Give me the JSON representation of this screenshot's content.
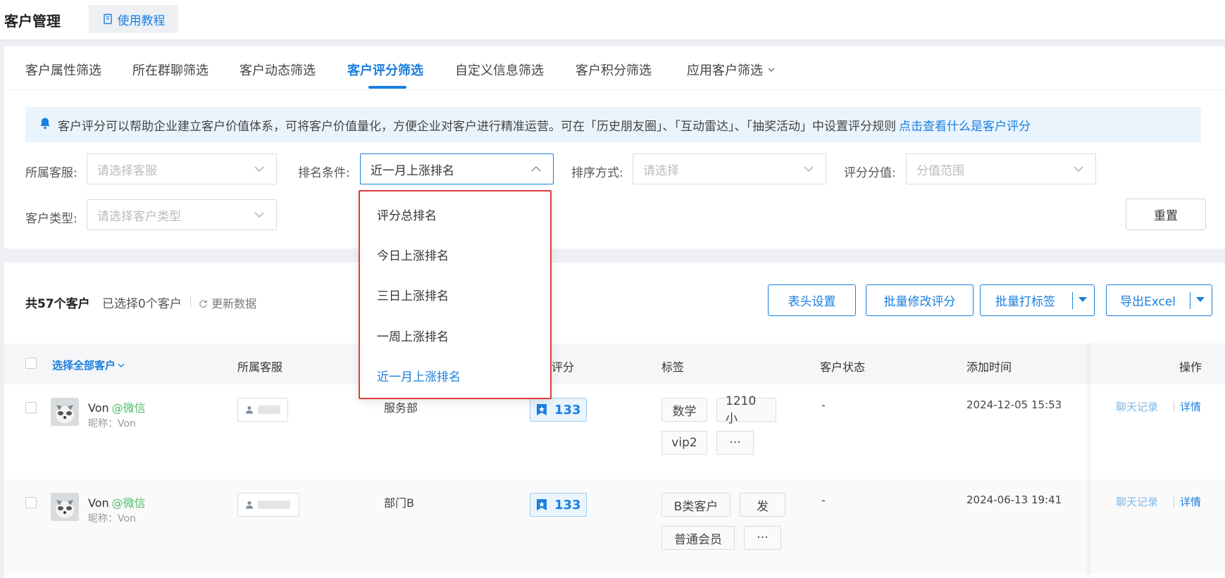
{
  "header": {
    "title": "客户管理",
    "tutorial_label": "使用教程"
  },
  "tabs": [
    {
      "label": "客户属性筛选"
    },
    {
      "label": "所在群聊筛选"
    },
    {
      "label": "客户动态筛选"
    },
    {
      "label": "客户评分筛选",
      "active": true
    },
    {
      "label": "自定义信息筛选"
    },
    {
      "label": "客户积分筛选"
    },
    {
      "label": "应用客户筛选"
    }
  ],
  "notice": {
    "text": "客户评分可以帮助企业建立客户价值体系，可将客户价值量化，方便企业对客户进行精准运营。可在「历史朋友圈」、「互动雷达」、「抽奖活动」中设置评分规则",
    "link": "点击查看什么是客户评分"
  },
  "filters": {
    "agent": {
      "label": "所属客服:",
      "placeholder": "请选择客服"
    },
    "rank": {
      "label": "排名条件:",
      "value": "近一月上涨排名"
    },
    "sort": {
      "label": "排序方式:",
      "placeholder": "请选择"
    },
    "score_value": {
      "label": "评分分值:",
      "placeholder": "分值范围"
    },
    "customer_type": {
      "label": "客户类型:",
      "placeholder": "请选择客户类型"
    },
    "reset_label": "重置"
  },
  "rank_dropdown": {
    "options": [
      "评分总排名",
      "今日上涨排名",
      "三日上涨排名",
      "一周上涨排名",
      "近一月上涨排名"
    ],
    "selected": "近一月上涨排名"
  },
  "list": {
    "count_text": "共57个客户",
    "selected_text": "已选择0个客户",
    "refresh_label": "更新数据",
    "buttons": {
      "header_settings": "表头设置",
      "batch_score": "批量修改评分",
      "batch_tag": "批量打标签",
      "export": "导出Excel"
    },
    "columns": {
      "select_all": "选择全部客户",
      "agent": "所属客服",
      "score": "评分",
      "tags": "标签",
      "status": "客户状态",
      "added": "添加时间",
      "ops": "操作"
    },
    "rows": [
      {
        "name": "Von",
        "channel": "@微信",
        "nickname": "昵称：Von",
        "dept": "服务部",
        "score": "133",
        "tags": [
          "数学",
          "1210小",
          "vip2",
          "···"
        ],
        "status": "-",
        "added": "2024-12-05 15:53",
        "chat_label": "聊天记录",
        "detail_label": "详情"
      },
      {
        "name": "Von",
        "channel": "@微信",
        "nickname": "昵称：Von",
        "dept": "部门B",
        "score": "133",
        "tags": [
          "B类客户",
          "发",
          "普通会员",
          "···"
        ],
        "status": "-",
        "added": "2024-06-13 19:41",
        "chat_label": "聊天记录",
        "detail_label": "详情"
      }
    ]
  },
  "colors": {
    "accent": "#1a7fe0",
    "highlight_border": "#e23b3b",
    "wechat_green": "#4cbf6a"
  }
}
